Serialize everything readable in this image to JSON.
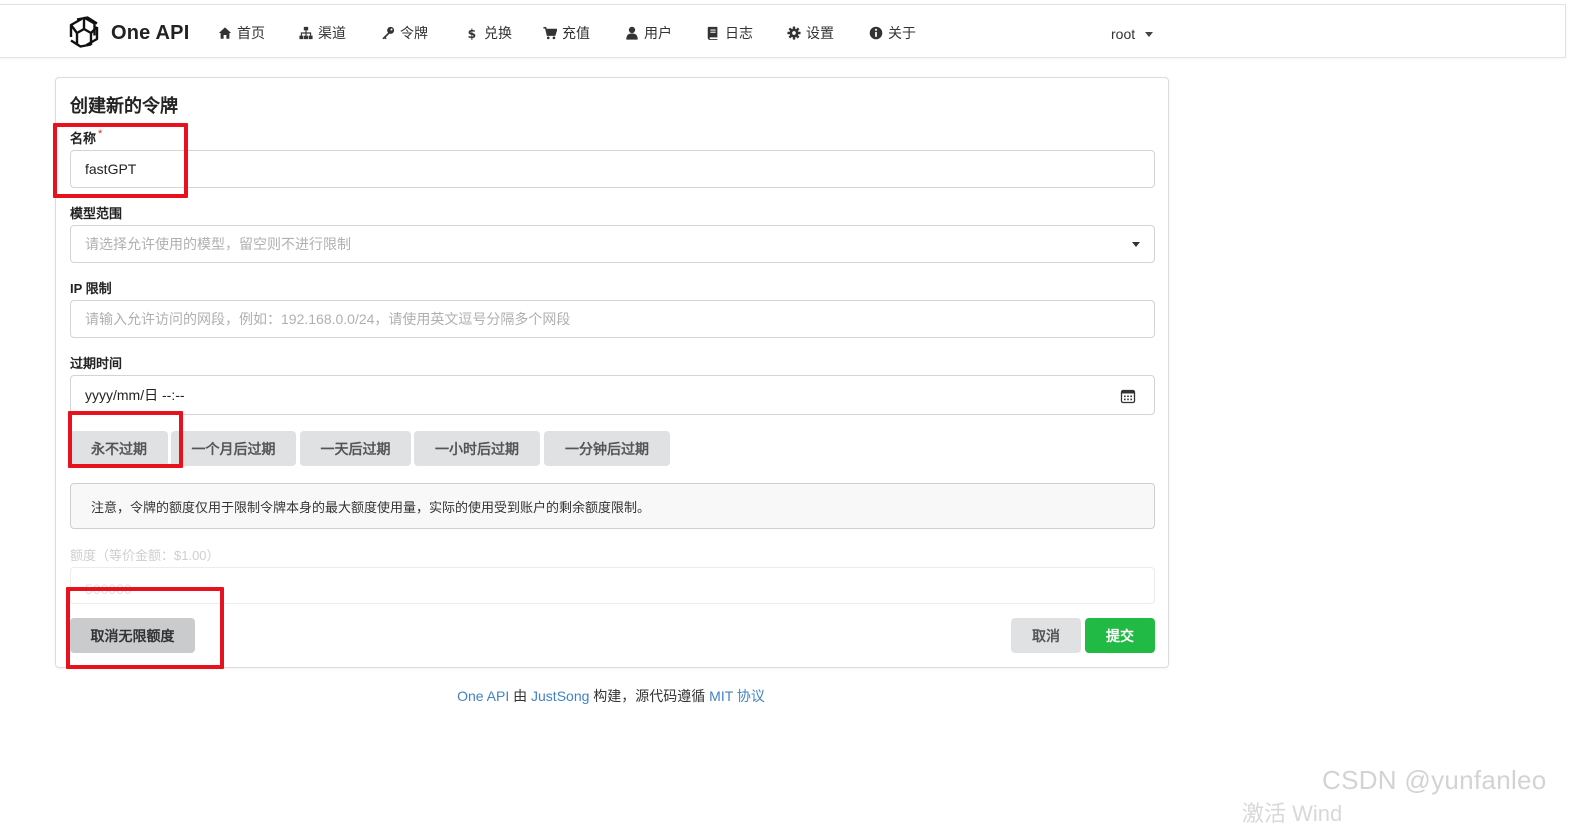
{
  "header": {
    "brand": "One API",
    "nav": [
      {
        "label": "首页",
        "icon": "home-icon"
      },
      {
        "label": "渠道",
        "icon": "sitemap-icon"
      },
      {
        "label": "令牌",
        "icon": "key-icon"
      },
      {
        "label": "兑换",
        "icon": "dollar-icon"
      },
      {
        "label": "充值",
        "icon": "cart-icon"
      },
      {
        "label": "用户",
        "icon": "user-icon"
      },
      {
        "label": "日志",
        "icon": "book-icon"
      },
      {
        "label": "设置",
        "icon": "gear-icon"
      },
      {
        "label": "关于",
        "icon": "info-icon"
      }
    ],
    "user": "root"
  },
  "form": {
    "title": "创建新的令牌",
    "name_label": "名称",
    "required_mark": "*",
    "name_value": "fastGPT",
    "model_label": "模型范围",
    "model_placeholder": "请选择允许使用的模型，留空则不进行限制",
    "ip_label": "IP 限制",
    "ip_placeholder": "请输入允许访问的网段，例如：192.168.0.0/24，请使用英文逗号分隔多个网段",
    "expire_label": "过期时间",
    "expire_value": "yyyy/mm/日 --:--",
    "expire_buttons": [
      "永不过期",
      "一个月后过期",
      "一天后过期",
      "一小时后过期",
      "一分钟后过期"
    ],
    "notice": "注意，令牌的额度仅用于限制令牌本身的最大额度使用量，实际的使用受到账户的剩余额度限制。",
    "quota_label": "额度（等价金额：$1.00）",
    "quota_value": "500000",
    "unlimited_button": "取消无限额度",
    "cancel_button": "取消",
    "submit_button": "提交"
  },
  "footer": {
    "link1": "One API",
    "text1": " 由 ",
    "link2": "JustSong",
    "text2": " 构建，源代码遵循 ",
    "link3": "MIT 协议"
  },
  "watermark": "CSDN @yunfanleo",
  "watermark2": "激活 Wind",
  "colors": {
    "accent_green": "#21ba45",
    "link_blue": "#4183c4",
    "annotation_red": "#e8121f"
  }
}
